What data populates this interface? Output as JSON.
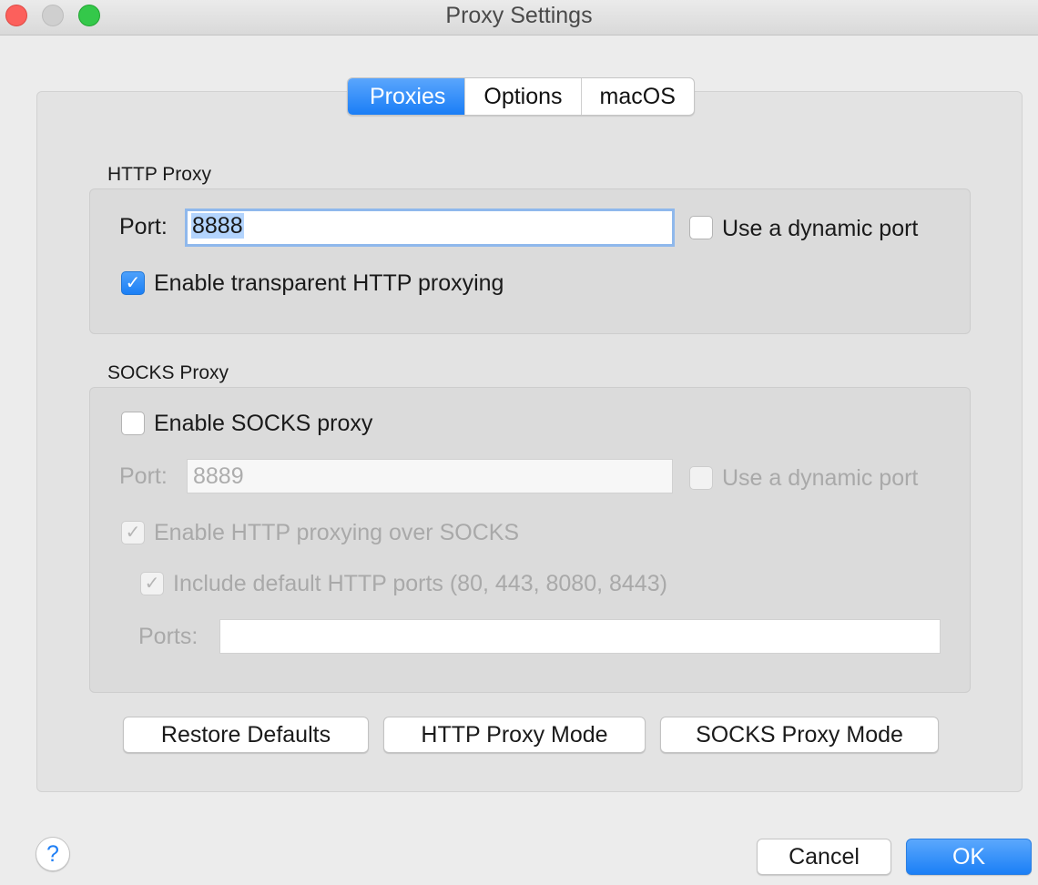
{
  "window": {
    "title": "Proxy Settings"
  },
  "tabs": [
    {
      "label": "Proxies",
      "active": true
    },
    {
      "label": "Options",
      "active": false
    },
    {
      "label": "macOS",
      "active": false
    }
  ],
  "http_proxy": {
    "section_label": "HTTP Proxy",
    "port_label": "Port:",
    "port_value": "8888",
    "dynamic_port_label": "Use a dynamic port",
    "dynamic_port_checked": false,
    "transparent_label": "Enable transparent HTTP proxying",
    "transparent_checked": true
  },
  "socks_proxy": {
    "section_label": "SOCKS Proxy",
    "enable_label": "Enable SOCKS proxy",
    "enable_checked": false,
    "port_label": "Port:",
    "port_value": "8889",
    "dynamic_port_label": "Use a dynamic port",
    "dynamic_port_checked": false,
    "http_over_socks_label": "Enable HTTP proxying over SOCKS",
    "http_over_socks_checked": true,
    "include_default_label": "Include default HTTP ports (80, 443, 8080, 8443)",
    "include_default_checked": true,
    "ports_label": "Ports:",
    "ports_value": ""
  },
  "buttons": {
    "restore_defaults": "Restore Defaults",
    "http_proxy_mode": "HTTP Proxy Mode",
    "socks_proxy_mode": "SOCKS Proxy Mode",
    "cancel": "Cancel",
    "ok": "OK",
    "help": "?"
  },
  "glyphs": {
    "check": "✓"
  },
  "colors": {
    "accent": "#1b7ff6",
    "close": "#fc605c",
    "maximize": "#34c84a"
  }
}
